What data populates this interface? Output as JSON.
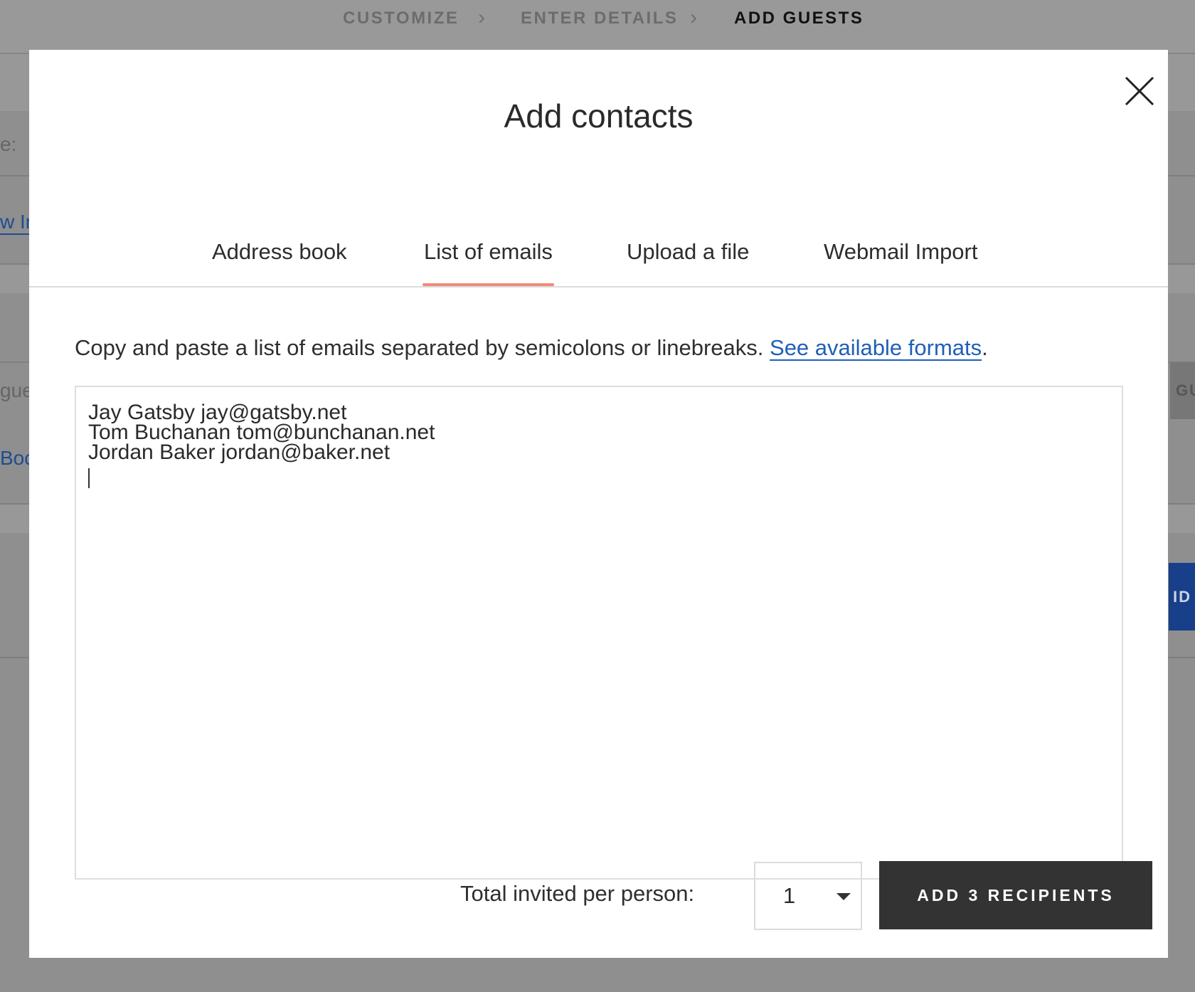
{
  "stepper": {
    "steps": [
      "CUSTOMIZE",
      "ENTER DETAILS",
      "ADD GUESTS"
    ],
    "active_step": "ADD GUESTS"
  },
  "background": {
    "fragment_1": "e:",
    "fragment_2": "w In",
    "fragment_3": "gue",
    "fragment_4": "Boc",
    "fragment_5": "GU",
    "fragment_6": "ID"
  },
  "modal": {
    "title": "Add contacts",
    "close_icon": "close-icon",
    "tabs": [
      "Address book",
      "List of emails",
      "Upload a file",
      "Webmail Import"
    ],
    "active_tab": "List of emails",
    "instructions": "Copy and paste a list of emails separated by semicolons or linebreaks.",
    "formats_link": "See available formats",
    "instructions_end": ".",
    "emails": [
      "Jay Gatsby jay@gatsby.net",
      "Tom Buchanan tom@bunchanan.net",
      "Jordan Baker jordan@baker.net"
    ],
    "per_person_label": "Total invited per person:",
    "per_person_value": "1",
    "add_button": "ADD 3 RECIPIENTS"
  },
  "colors": {
    "tab_underline": "#f08a7a",
    "link": "#1f5fb8",
    "primary_button": "#333333",
    "overlay_background": "#8f8f8f"
  }
}
